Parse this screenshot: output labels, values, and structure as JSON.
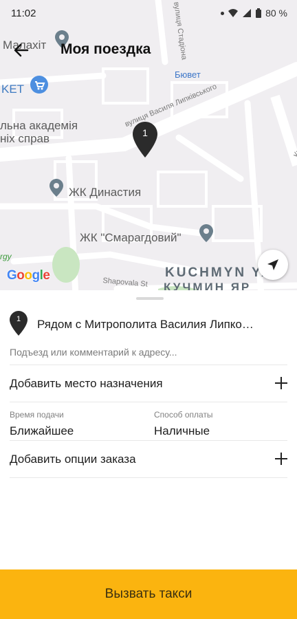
{
  "status_bar": {
    "time": "11:02",
    "battery": "80 %"
  },
  "header": {
    "title": "Моя поездка"
  },
  "map": {
    "labels": {
      "malakhit": "Малахіт",
      "ket": "KET",
      "academy_line1": "льна академія",
      "academy_line2": "ніх справ",
      "dynasty": "ЖК Династия",
      "smarag": "ЖК \"Смарагдовий\"",
      "bjuvet": "Бювет",
      "street_lipk": "вулиця Василя Липківського",
      "street_stadion": "вулиця Стадіона",
      "street_shapovala": "Shapovala St",
      "kuchmyn_lat": "KUCHMYN YAR",
      "kuchmyn_cyr": "КУЧМИН ЯР",
      "kudr": "Кудр",
      "green_text": "rgy",
      "google": "Google"
    },
    "pin_number": "1"
  },
  "trip": {
    "pickup_number": "1",
    "pickup_address": "Рядом с Митрополита Василия Липко…",
    "comment_placeholder": "Подъезд или комментарий к адресу...",
    "add_destination_label": "Добавить место назначения",
    "pickup_time_caption": "Время подачи",
    "pickup_time_value": "Ближайшее",
    "payment_caption": "Способ оплаты",
    "payment_value": "Наличные",
    "add_options_label": "Добавить опции заказа"
  },
  "actions": {
    "call_taxi_label": "Вызвать такси"
  },
  "colors": {
    "accent": "#fbb40f",
    "map_background": "#f0eef1",
    "pin": "#2b2b2b"
  }
}
